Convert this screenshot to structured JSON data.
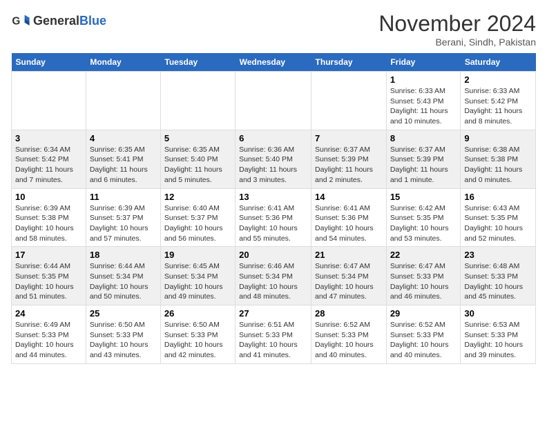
{
  "logo": {
    "general": "General",
    "blue": "Blue"
  },
  "title": "November 2024",
  "subtitle": "Berani, Sindh, Pakistan",
  "days_header": [
    "Sunday",
    "Monday",
    "Tuesday",
    "Wednesday",
    "Thursday",
    "Friday",
    "Saturday"
  ],
  "weeks": [
    [
      {
        "day": "",
        "content": ""
      },
      {
        "day": "",
        "content": ""
      },
      {
        "day": "",
        "content": ""
      },
      {
        "day": "",
        "content": ""
      },
      {
        "day": "",
        "content": ""
      },
      {
        "day": "1",
        "content": "Sunrise: 6:33 AM\nSunset: 5:43 PM\nDaylight: 11 hours and 10 minutes."
      },
      {
        "day": "2",
        "content": "Sunrise: 6:33 AM\nSunset: 5:42 PM\nDaylight: 11 hours and 8 minutes."
      }
    ],
    [
      {
        "day": "3",
        "content": "Sunrise: 6:34 AM\nSunset: 5:42 PM\nDaylight: 11 hours and 7 minutes."
      },
      {
        "day": "4",
        "content": "Sunrise: 6:35 AM\nSunset: 5:41 PM\nDaylight: 11 hours and 6 minutes."
      },
      {
        "day": "5",
        "content": "Sunrise: 6:35 AM\nSunset: 5:40 PM\nDaylight: 11 hours and 5 minutes."
      },
      {
        "day": "6",
        "content": "Sunrise: 6:36 AM\nSunset: 5:40 PM\nDaylight: 11 hours and 3 minutes."
      },
      {
        "day": "7",
        "content": "Sunrise: 6:37 AM\nSunset: 5:39 PM\nDaylight: 11 hours and 2 minutes."
      },
      {
        "day": "8",
        "content": "Sunrise: 6:37 AM\nSunset: 5:39 PM\nDaylight: 11 hours and 1 minute."
      },
      {
        "day": "9",
        "content": "Sunrise: 6:38 AM\nSunset: 5:38 PM\nDaylight: 11 hours and 0 minutes."
      }
    ],
    [
      {
        "day": "10",
        "content": "Sunrise: 6:39 AM\nSunset: 5:38 PM\nDaylight: 10 hours and 58 minutes."
      },
      {
        "day": "11",
        "content": "Sunrise: 6:39 AM\nSunset: 5:37 PM\nDaylight: 10 hours and 57 minutes."
      },
      {
        "day": "12",
        "content": "Sunrise: 6:40 AM\nSunset: 5:37 PM\nDaylight: 10 hours and 56 minutes."
      },
      {
        "day": "13",
        "content": "Sunrise: 6:41 AM\nSunset: 5:36 PM\nDaylight: 10 hours and 55 minutes."
      },
      {
        "day": "14",
        "content": "Sunrise: 6:41 AM\nSunset: 5:36 PM\nDaylight: 10 hours and 54 minutes."
      },
      {
        "day": "15",
        "content": "Sunrise: 6:42 AM\nSunset: 5:35 PM\nDaylight: 10 hours and 53 minutes."
      },
      {
        "day": "16",
        "content": "Sunrise: 6:43 AM\nSunset: 5:35 PM\nDaylight: 10 hours and 52 minutes."
      }
    ],
    [
      {
        "day": "17",
        "content": "Sunrise: 6:44 AM\nSunset: 5:35 PM\nDaylight: 10 hours and 51 minutes."
      },
      {
        "day": "18",
        "content": "Sunrise: 6:44 AM\nSunset: 5:34 PM\nDaylight: 10 hours and 50 minutes."
      },
      {
        "day": "19",
        "content": "Sunrise: 6:45 AM\nSunset: 5:34 PM\nDaylight: 10 hours and 49 minutes."
      },
      {
        "day": "20",
        "content": "Sunrise: 6:46 AM\nSunset: 5:34 PM\nDaylight: 10 hours and 48 minutes."
      },
      {
        "day": "21",
        "content": "Sunrise: 6:47 AM\nSunset: 5:34 PM\nDaylight: 10 hours and 47 minutes."
      },
      {
        "day": "22",
        "content": "Sunrise: 6:47 AM\nSunset: 5:33 PM\nDaylight: 10 hours and 46 minutes."
      },
      {
        "day": "23",
        "content": "Sunrise: 6:48 AM\nSunset: 5:33 PM\nDaylight: 10 hours and 45 minutes."
      }
    ],
    [
      {
        "day": "24",
        "content": "Sunrise: 6:49 AM\nSunset: 5:33 PM\nDaylight: 10 hours and 44 minutes."
      },
      {
        "day": "25",
        "content": "Sunrise: 6:50 AM\nSunset: 5:33 PM\nDaylight: 10 hours and 43 minutes."
      },
      {
        "day": "26",
        "content": "Sunrise: 6:50 AM\nSunset: 5:33 PM\nDaylight: 10 hours and 42 minutes."
      },
      {
        "day": "27",
        "content": "Sunrise: 6:51 AM\nSunset: 5:33 PM\nDaylight: 10 hours and 41 minutes."
      },
      {
        "day": "28",
        "content": "Sunrise: 6:52 AM\nSunset: 5:33 PM\nDaylight: 10 hours and 40 minutes."
      },
      {
        "day": "29",
        "content": "Sunrise: 6:52 AM\nSunset: 5:33 PM\nDaylight: 10 hours and 40 minutes."
      },
      {
        "day": "30",
        "content": "Sunrise: 6:53 AM\nSunset: 5:33 PM\nDaylight: 10 hours and 39 minutes."
      }
    ]
  ]
}
